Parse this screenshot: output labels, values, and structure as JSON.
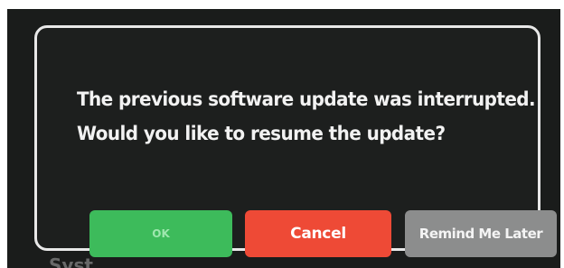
{
  "dialog": {
    "message_line1": "The previous software update was interrupted.",
    "message_line2": "Would you like to resume the update?",
    "ok_label": "OK",
    "cancel_label": "Cancel",
    "remind_label": "Remind Me Later"
  },
  "colors": {
    "ok": "#3dbb5b",
    "cancel": "#ee4a36",
    "remind": "#8c8d8d",
    "dialog_border": "#e8e8e8",
    "screen_background": "#1a1c1b"
  }
}
